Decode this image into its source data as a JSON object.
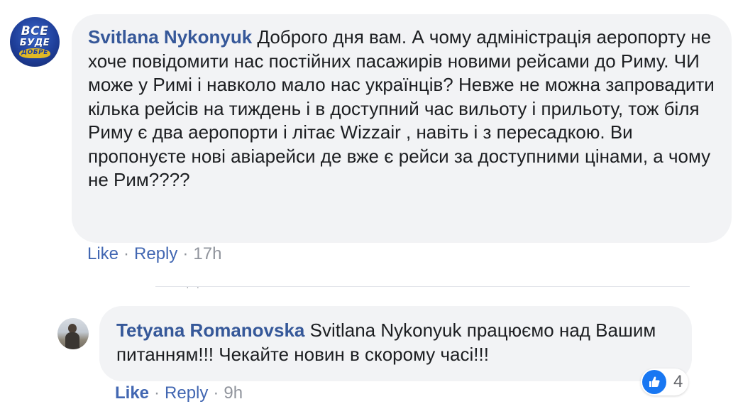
{
  "comments": [
    {
      "author": "Svitlana Nykonyuk",
      "text": "Доброго дня вам. А чому адміністрація аеропорту не хоче повідомити нас постійних пасажирів новими рейсами до Риму. ЧИ може у Римі і навколо мало нас українців? Невже не можна запровадити кілька рейсів на тиждень і в доступний час вильоту і прильоту, тож біля Риму є два аеропорти і літає Wizzair , навіть і з пересадкою. Ви пропонуєте нові авіарейси де вже є рейси за доступними цінами, а чому не Рим????",
      "like_label": "Like",
      "reply_label": "Reply",
      "time": "17h",
      "avatar_text": [
        "ВСЕ",
        "БУДЕ",
        "ДОБРЕ"
      ]
    }
  ],
  "replies": [
    {
      "author": "Tetyana Romanovska",
      "text": "Svitlana Nykonyuk працюємо над Вашим питанням!!! Чекайте новин в скорому часі!!!",
      "like_label": "Like",
      "reply_label": "Reply",
      "time": "9h",
      "reaction_count": "4"
    }
  ],
  "colors": {
    "author": "#365899",
    "action_link": "#4267b2",
    "bubble": "#f2f3f5",
    "like_blue": "#1877f2"
  },
  "icons": [
    "logo-avatar",
    "user-avatar-photo",
    "like-reaction-icon"
  ]
}
